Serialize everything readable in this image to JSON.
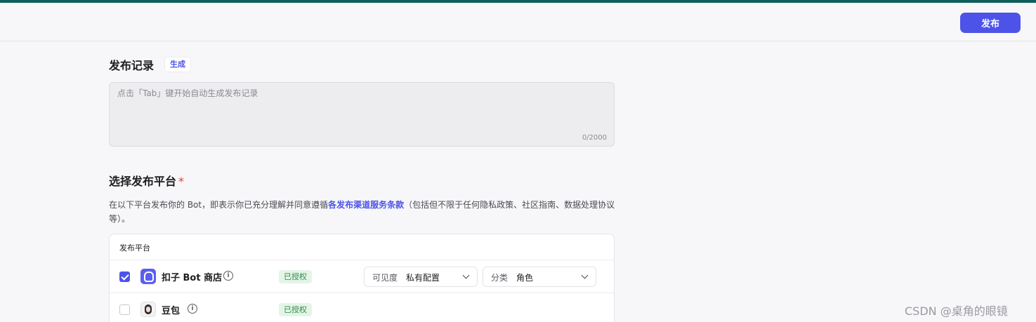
{
  "header": {
    "publish_label": "发布"
  },
  "record": {
    "title": "发布记录",
    "generate_label": "生成",
    "placeholder": "点击「Tab」键开始自动生成发布记录",
    "counter": "0/2000"
  },
  "platforms": {
    "title": "选择发布平台",
    "required_mark": "*",
    "desc_before": "在以下平台发布你的 Bot，即表示你已充分理解并同意遵循",
    "desc_link": "各发布渠道服务条款",
    "desc_after": "（包括但不限于任何隐私政策、社区指南、数据处理协议等）。",
    "table_header": "发布平台",
    "rows": [
      {
        "name": "扣子 Bot 商店",
        "checked": true,
        "status": "已授权",
        "visibility_label": "可见度",
        "visibility_value": "私有配置",
        "category_label": "分类",
        "category_value": "角色"
      },
      {
        "name": "豆包",
        "checked": false,
        "status": "已授权"
      }
    ]
  },
  "watermark": "CSDN @桌角的眼镜",
  "colors": {
    "accent": "#4d53e8",
    "topline": "#0e5f5c",
    "authorized_bg": "#e4f5e8",
    "authorized_text": "#2e8b47"
  },
  "icons": [
    "coze-bot-store-icon",
    "doubao-icon",
    "info-icon",
    "chevron-down-icon",
    "checkbox-checked-icon"
  ]
}
